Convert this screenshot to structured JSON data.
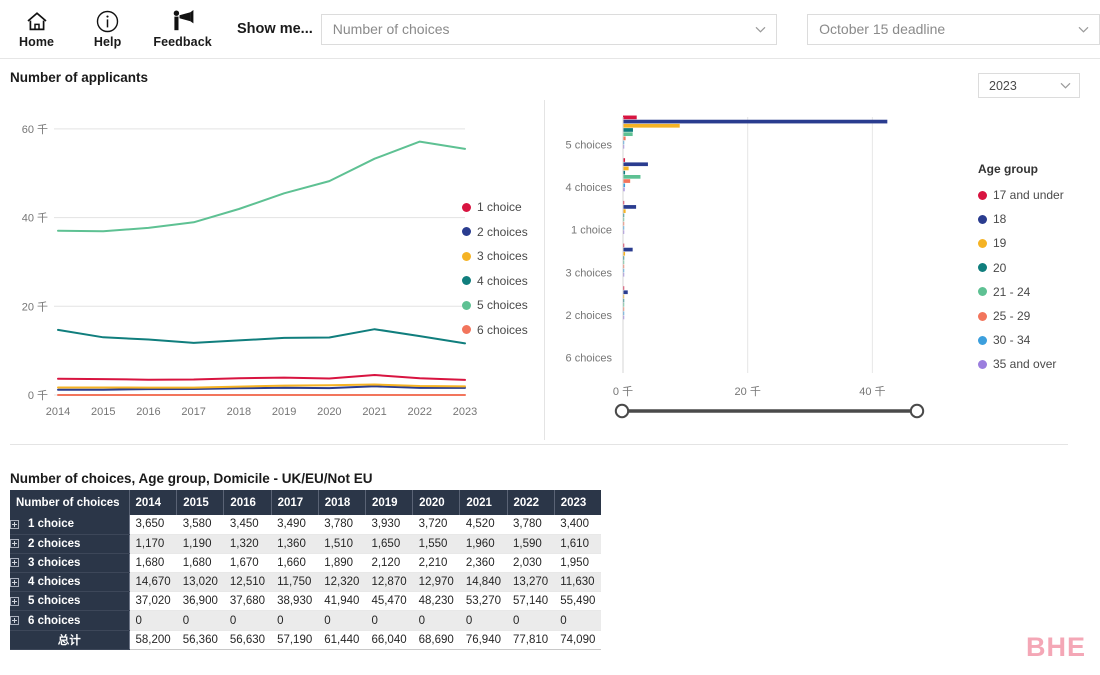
{
  "toolbar": {
    "buttons": [
      {
        "label": "Home",
        "icon": "home-icon"
      },
      {
        "label": "Help",
        "icon": "info-circle-icon"
      },
      {
        "label": "Feedback",
        "icon": "megaphone-icon"
      }
    ],
    "show_me_label": "Show me...",
    "measure_select": {
      "value": "Number of choices",
      "icon": "chevron-down-icon"
    },
    "deadline_select": {
      "value": "October 15 deadline",
      "icon": "chevron-down-icon"
    }
  },
  "applicants": {
    "title": "Number of applicants",
    "year_select": {
      "value": "2023",
      "icon": "chevron-down-icon"
    }
  },
  "line_legend": {
    "items": [
      {
        "label": "1 choice",
        "color": "#d81440"
      },
      {
        "label": "2 choices",
        "color": "#2a3c8f"
      },
      {
        "label": "3 choices",
        "color": "#f5b324"
      },
      {
        "label": "4 choices",
        "color": "#107e7d"
      },
      {
        "label": "5 choices",
        "color": "#5ec193"
      },
      {
        "label": "6 choices",
        "color": "#f2755c"
      }
    ]
  },
  "age_legend": {
    "title": "Age group",
    "items": [
      {
        "label": "17 and under",
        "color": "#d81440"
      },
      {
        "label": "18",
        "color": "#2a3c8f"
      },
      {
        "label": "19",
        "color": "#f5b324"
      },
      {
        "label": "20",
        "color": "#107e7d"
      },
      {
        "label": "21 - 24",
        "color": "#5ec193"
      },
      {
        "label": "25 - 29",
        "color": "#f2755c"
      },
      {
        "label": "30 - 34",
        "color": "#3c9fdd"
      },
      {
        "label": "35 and over",
        "color": "#9b7ede"
      }
    ]
  },
  "slider": {
    "min_label": "0 千",
    "max_label": "40 千"
  },
  "table": {
    "title": "Number of choices, Age group, Domicile - UK/EU/Not EU",
    "first_col_header": "Number of choices",
    "year_headers": [
      "2014",
      "2015",
      "2016",
      "2017",
      "2018",
      "2019",
      "2020",
      "2021",
      "2022",
      "2023"
    ],
    "rows": [
      {
        "label": "1 choice",
        "values": [
          "3,650",
          "3,580",
          "3,450",
          "3,490",
          "3,780",
          "3,930",
          "3,720",
          "4,520",
          "3,780",
          "3,400"
        ]
      },
      {
        "label": "2 choices",
        "values": [
          "1,170",
          "1,190",
          "1,320",
          "1,360",
          "1,510",
          "1,650",
          "1,550",
          "1,960",
          "1,590",
          "1,610"
        ]
      },
      {
        "label": "3 choices",
        "values": [
          "1,680",
          "1,680",
          "1,670",
          "1,660",
          "1,890",
          "2,120",
          "2,210",
          "2,360",
          "2,030",
          "1,950"
        ]
      },
      {
        "label": "4 choices",
        "values": [
          "14,670",
          "13,020",
          "12,510",
          "11,750",
          "12,320",
          "12,870",
          "12,970",
          "14,840",
          "13,270",
          "11,630"
        ]
      },
      {
        "label": "5 choices",
        "values": [
          "37,020",
          "36,900",
          "37,680",
          "38,930",
          "41,940",
          "45,470",
          "48,230",
          "53,270",
          "57,140",
          "55,490"
        ]
      },
      {
        "label": "6 choices",
        "values": [
          "0",
          "0",
          "0",
          "0",
          "0",
          "0",
          "0",
          "0",
          "0",
          "0"
        ]
      }
    ],
    "total_row": {
      "label": "总计",
      "values": [
        "58,200",
        "56,360",
        "56,630",
        "57,190",
        "61,440",
        "66,040",
        "68,690",
        "76,940",
        "77,810",
        "74,090"
      ]
    }
  },
  "watermark": {
    "text": "BHE"
  },
  "chart_data": [
    {
      "type": "line",
      "title": "Number of applicants",
      "xlabel": "",
      "ylabel": "",
      "x": [
        "2014",
        "2015",
        "2016",
        "2017",
        "2018",
        "2019",
        "2020",
        "2021",
        "2022",
        "2023"
      ],
      "ylim": [
        0,
        62000
      ],
      "yticks": [
        0,
        20000,
        40000,
        60000
      ],
      "ytick_labels": [
        "0 千",
        "20 千",
        "40 千",
        "60 千"
      ],
      "grid": true,
      "legend_position": "right",
      "series": [
        {
          "name": "1 choice",
          "color": "#d81440",
          "values": [
            3650,
            3580,
            3450,
            3490,
            3780,
            3930,
            3720,
            4520,
            3780,
            3400
          ]
        },
        {
          "name": "2 choices",
          "color": "#2a3c8f",
          "values": [
            1170,
            1190,
            1320,
            1360,
            1510,
            1650,
            1550,
            1960,
            1590,
            1610
          ]
        },
        {
          "name": "3 choices",
          "color": "#f5b324",
          "values": [
            1680,
            1680,
            1670,
            1660,
            1890,
            2120,
            2210,
            2360,
            2030,
            1950
          ]
        },
        {
          "name": "4 choices",
          "color": "#107e7d",
          "values": [
            14670,
            13020,
            12510,
            11750,
            12320,
            12870,
            12970,
            14840,
            13270,
            11630
          ]
        },
        {
          "name": "5 choices",
          "color": "#5ec193",
          "values": [
            37020,
            36900,
            37680,
            38930,
            41940,
            45470,
            48230,
            53270,
            57140,
            55490
          ]
        },
        {
          "name": "6 choices",
          "color": "#f2755c",
          "values": [
            0,
            0,
            0,
            0,
            0,
            0,
            0,
            0,
            0,
            0
          ]
        }
      ]
    },
    {
      "type": "bar",
      "orientation": "horizontal",
      "title": "",
      "xlabel": "",
      "ylabel": "",
      "categories": [
        "5 choices",
        "4 choices",
        "1 choice",
        "3 choices",
        "2 choices",
        "6 choices"
      ],
      "xlim": [
        0,
        47000
      ],
      "xticks": [
        0,
        20000,
        40000
      ],
      "xtick_labels": [
        "0 千",
        "20 千",
        "40 千"
      ],
      "grid": true,
      "legend_position": "right",
      "series": [
        {
          "name": "17 and under",
          "color": "#d81440",
          "values": [
            2200,
            330,
            110,
            90,
            60,
            0
          ]
        },
        {
          "name": "18",
          "color": "#2a3c8f",
          "values": [
            42400,
            4000,
            2100,
            1550,
            760,
            0
          ]
        },
        {
          "name": "19",
          "color": "#f5b324",
          "values": [
            9100,
            900,
            420,
            330,
            160,
            0
          ]
        },
        {
          "name": "20",
          "color": "#107e7d",
          "values": [
            1600,
            330,
            110,
            70,
            40,
            0
          ]
        },
        {
          "name": "21 - 24",
          "color": "#5ec193",
          "values": [
            1550,
            2800,
            150,
            80,
            50,
            0
          ]
        },
        {
          "name": "25 - 29",
          "color": "#f2755c",
          "values": [
            420,
            1150,
            100,
            50,
            30,
            0
          ]
        },
        {
          "name": "30 - 34",
          "color": "#3c9fdd",
          "values": [
            180,
            330,
            170,
            40,
            20,
            0
          ]
        },
        {
          "name": "35 and over",
          "color": "#9b7ede",
          "values": [
            120,
            260,
            140,
            40,
            20,
            0
          ]
        }
      ]
    }
  ]
}
